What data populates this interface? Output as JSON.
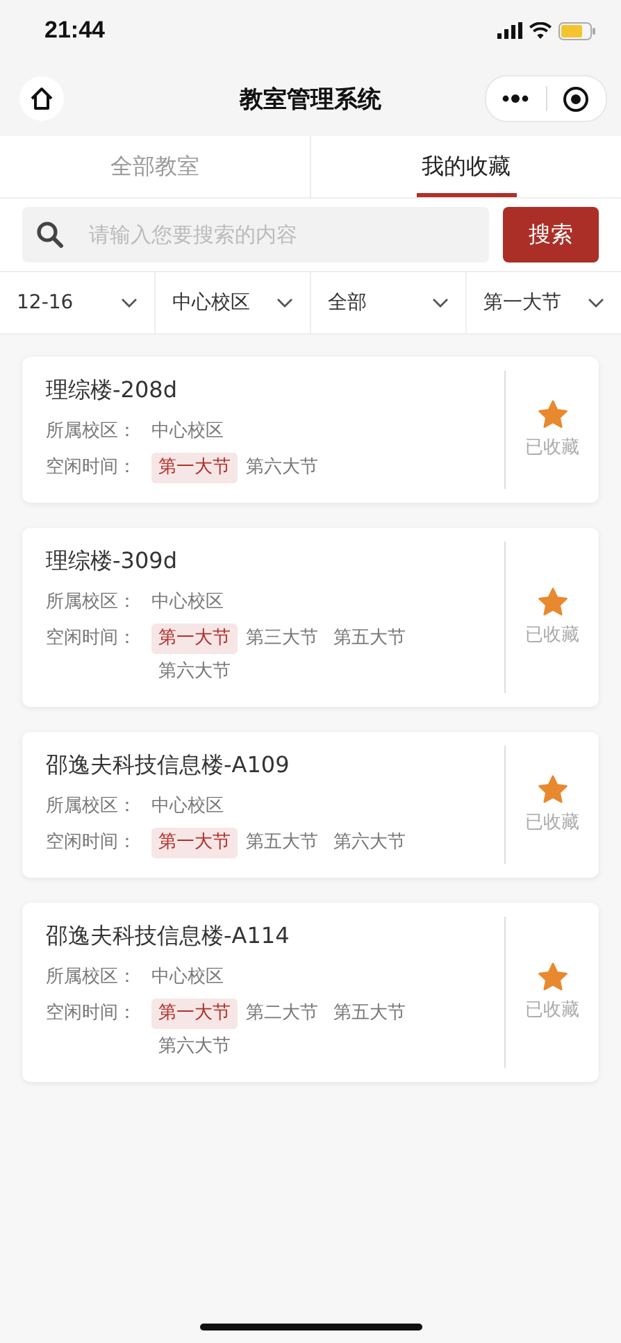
{
  "status_bar": {
    "time": "21:44"
  },
  "nav": {
    "title": "教室管理系统"
  },
  "tabs": [
    {
      "label": "全部教室",
      "selected": false
    },
    {
      "label": "我的收藏",
      "selected": true
    }
  ],
  "search": {
    "placeholder": "请输入您要搜索的内容",
    "button": "搜索"
  },
  "filters": [
    {
      "label": "12-16"
    },
    {
      "label": "中心校区"
    },
    {
      "label": "全部"
    },
    {
      "label": "第一大节"
    }
  ],
  "rooms": [
    {
      "name": "理综楼-208d",
      "campus_label": "所属校区：",
      "campus": "中心校区",
      "time_label": "空闲时间：",
      "slots": [
        {
          "label": "第一大节",
          "highlighted": true
        },
        {
          "label": "第六大节",
          "highlighted": false
        }
      ],
      "favorited": true,
      "favorite_label": "已收藏"
    },
    {
      "name": "理综楼-309d",
      "campus_label": "所属校区：",
      "campus": "中心校区",
      "time_label": "空闲时间：",
      "slots": [
        {
          "label": "第一大节",
          "highlighted": true
        },
        {
          "label": "第三大节",
          "highlighted": false
        },
        {
          "label": "第五大节",
          "highlighted": false
        },
        {
          "label": "第六大节",
          "highlighted": false
        }
      ],
      "favorited": true,
      "favorite_label": "已收藏"
    },
    {
      "name": "邵逸夫科技信息楼-A109",
      "campus_label": "所属校区：",
      "campus": "中心校区",
      "time_label": "空闲时间：",
      "slots": [
        {
          "label": "第一大节",
          "highlighted": true
        },
        {
          "label": "第五大节",
          "highlighted": false
        },
        {
          "label": "第六大节",
          "highlighted": false
        }
      ],
      "favorited": true,
      "favorite_label": "已收藏"
    },
    {
      "name": "邵逸夫科技信息楼-A114",
      "campus_label": "所属校区：",
      "campus": "中心校区",
      "time_label": "空闲时间：",
      "slots": [
        {
          "label": "第一大节",
          "highlighted": true
        },
        {
          "label": "第二大节",
          "highlighted": false
        },
        {
          "label": "第五大节",
          "highlighted": false
        },
        {
          "label": "第六大节",
          "highlighted": false
        }
      ],
      "favorited": true,
      "favorite_label": "已收藏"
    }
  ]
}
